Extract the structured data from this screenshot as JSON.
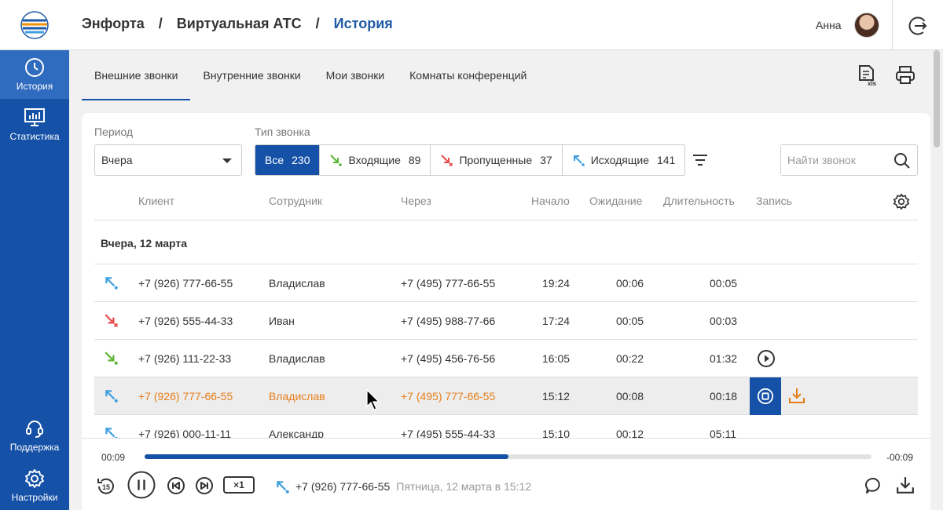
{
  "breadcrumb": {
    "part1": "Энфорта",
    "part2": "Виртуальная АТС",
    "current": "История",
    "sep": "/"
  },
  "user": {
    "name": "Анна"
  },
  "sidebar": {
    "items": [
      {
        "label": "История",
        "icon": "clock-icon",
        "active": true
      },
      {
        "label": "Статистика",
        "icon": "chart-monitor-icon"
      },
      {
        "label": "Поддержка",
        "icon": "headset-icon"
      },
      {
        "label": "Настройки",
        "icon": "gear-icon"
      }
    ]
  },
  "tabs": [
    "Внешние звонки",
    "Внутренние звонки",
    "Мои звонки",
    "Комнаты конференций"
  ],
  "filters": {
    "period_label": "Период",
    "period_value": "Вчера",
    "type_label": "Тип звонка",
    "types": [
      {
        "label": "Все",
        "count": "230"
      },
      {
        "label": "Входящие",
        "count": "89"
      },
      {
        "label": "Пропущенные",
        "count": "37"
      },
      {
        "label": "Исходящие",
        "count": "141"
      }
    ],
    "search_placeholder": "Найти звонок"
  },
  "table": {
    "headers": [
      "Клиент",
      "Сотрудник",
      "Через",
      "Начало",
      "Ожидание",
      "Длительность",
      "Запись"
    ],
    "group": "Вчера, 12 марта",
    "rows": [
      {
        "dir": "outgoing",
        "client": "+7 (926) 777-66-55",
        "employee": "Владислав",
        "via": "+7 (495) 777-66-55",
        "start": "19:24",
        "wait": "00:06",
        "duration": "00:05"
      },
      {
        "dir": "missed",
        "client": "+7 (926) 555-44-33",
        "employee": "Иван",
        "via": "+7 (495) 988-77-66",
        "start": "17:24",
        "wait": "00:05",
        "duration": "00:03"
      },
      {
        "dir": "incoming",
        "client": "+7 (926) 111-22-33",
        "employee": "Владислав",
        "via": "+7 (495) 456-76-56",
        "start": "16:05",
        "wait": "00:22",
        "duration": "01:32"
      },
      {
        "dir": "outgoing",
        "client": "+7 (926) 777-66-55",
        "employee": "Владислав",
        "via": "+7 (495) 777-66-55",
        "start": "15:12",
        "wait": "00:08",
        "duration": "00:18"
      },
      {
        "dir": "outgoing",
        "client": "+7 (926) 000-11-11",
        "employee": "Александр",
        "via": "+7 (495) 555-44-33",
        "start": "15:10",
        "wait": "00:12",
        "duration": "05:11"
      }
    ]
  },
  "player": {
    "elapsed": "00:09",
    "remaining": "-00:09",
    "progress": 0.5,
    "speed": "×1",
    "number": "+7 (926) 777-66-55",
    "when": "Пятница, 12 марта в 15:12"
  },
  "colors": {
    "brand": "#1551a7",
    "accent": "#e77d19",
    "incoming": "#5cb531",
    "missed": "#e54b4b",
    "outgoing": "#3e9fe0"
  }
}
